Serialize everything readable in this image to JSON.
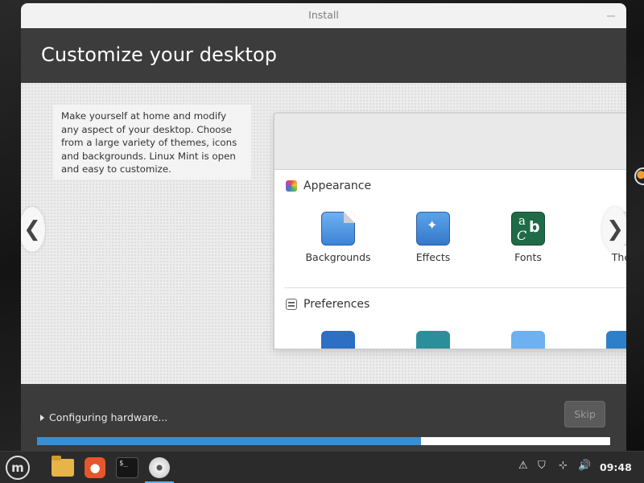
{
  "window": {
    "title": "Install",
    "heading": "Customize your desktop"
  },
  "slide": {
    "description": "Make yourself at home and modify any aspect of your desktop. Choose from a large variety of themes, icons and backgrounds. Linux Mint is open and easy to customize.",
    "sections": [
      {
        "title": "Appearance",
        "icon": "appearance-icon",
        "items": [
          {
            "label": "Backgrounds",
            "icon": "backgrounds-icon"
          },
          {
            "label": "Effects",
            "icon": "effects-icon"
          },
          {
            "label": "Fonts",
            "icon": "fonts-icon"
          },
          {
            "label": "Ther",
            "icon": "themes-icon"
          }
        ]
      },
      {
        "title": "Preferences",
        "icon": "preferences-icon",
        "items": [
          {
            "icon": "accessibility-icon"
          },
          {
            "icon": "account-details-icon"
          },
          {
            "icon": "applets-icon"
          },
          {
            "icon": "date-time-icon"
          }
        ]
      }
    ],
    "nav": {
      "prev": "❮",
      "next": "❯"
    }
  },
  "footer": {
    "status": "Configuring hardware...",
    "skip_label": "Skip",
    "progress": 0.67
  },
  "taskbar": {
    "apps": [
      {
        "icon": "mint-menu-icon"
      },
      {
        "icon": "files-icon"
      },
      {
        "icon": "firefox-icon"
      },
      {
        "icon": "terminal-icon"
      },
      {
        "icon": "install-disc-icon"
      }
    ],
    "terminal_prompt": "$_",
    "clock": "09:48",
    "colors": {
      "progress_fill": "#3d8ed0",
      "active_indicator": "#5cb0e8"
    }
  }
}
